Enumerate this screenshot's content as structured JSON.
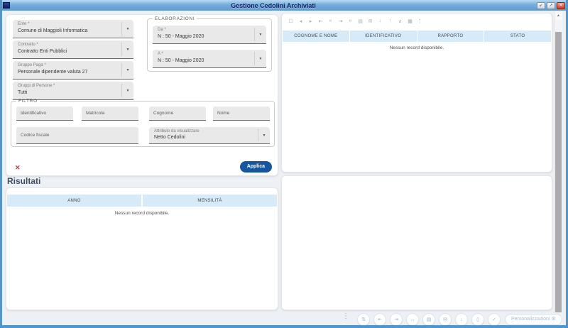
{
  "colors": {
    "accent": "#15569e",
    "titlebar": "#74addc",
    "table_header_bg": "#d6eaf7",
    "clear_red": "#c23b3b",
    "window_border": "#5494c7"
  },
  "window": {
    "title": "Gestione Cedolini Archiviati"
  },
  "icons": {
    "dropdown": "▼",
    "minimize": "↙",
    "maximize": "↗",
    "close": "✕",
    "clear": "✕",
    "more_vert": "⋮",
    "gear": "⚙",
    "scroll_up": "▲",
    "scroll_down": "▼"
  },
  "form": {
    "selects": [
      {
        "label": "Ente *",
        "value": "Comune di Maggioli Informatica"
      },
      {
        "label": "Contratto *",
        "value": "Contratto Enti Pubblici"
      },
      {
        "label": "Gruppo Paga *",
        "value": "Personale dipendente valuta 27"
      },
      {
        "label": "Gruppi di Persone *",
        "value": "Tutti"
      }
    ],
    "elaborazioni": {
      "legend": "ELABORAZIONI",
      "selects": [
        {
          "label": "Da *",
          "value": "N : 50 - Maggio 2020"
        },
        {
          "label": "A *",
          "value": "N : 50 - Maggio 2020"
        }
      ]
    },
    "filtro": {
      "legend": "FILTRO",
      "inputs": [
        {
          "placeholder": "Identificativo"
        },
        {
          "placeholder": "Matricola"
        },
        {
          "placeholder": "Cognome"
        },
        {
          "placeholder": "Nome"
        },
        {
          "placeholder": "Codice fiscale"
        }
      ],
      "attributo": {
        "label": "Attributo da visualizzare",
        "value": "Netto Cedolini"
      }
    },
    "apply_label": "Applica"
  },
  "results": {
    "title": "Risultati",
    "headers": [
      "ANNO",
      "MENSILITÀ"
    ],
    "empty_text": "Nessun record disponibile."
  },
  "archive": {
    "toolbar": [
      {
        "name": "select-all-icon",
        "glyph": "☐"
      },
      {
        "name": "nav-prev-icon",
        "glyph": "◂"
      },
      {
        "name": "nav-next-icon",
        "glyph": "▸"
      },
      {
        "name": "first-page-icon",
        "glyph": "⇤"
      },
      {
        "name": "page-back-icon",
        "glyph": "«"
      },
      {
        "name": "last-page-icon",
        "glyph": "⇥"
      },
      {
        "name": "page-forward-icon",
        "glyph": "»"
      },
      {
        "name": "copy-icon",
        "glyph": "▤"
      },
      {
        "name": "mail-icon",
        "glyph": "✉"
      },
      {
        "name": "download-icon",
        "glyph": "↓"
      },
      {
        "name": "upload-icon",
        "glyph": "↑"
      },
      {
        "name": "collapse-icon",
        "glyph": "∧"
      },
      {
        "name": "grid-icon",
        "glyph": "▦"
      },
      {
        "name": "more-icon",
        "glyph": "⋮"
      }
    ],
    "headers": [
      "COGNOME E NOME",
      "IDENTIFICATIVO",
      "RAPPORTO",
      "STATO"
    ],
    "empty_text": "Nessun record disponibile."
  },
  "bottom_toolbar": {
    "buttons": [
      {
        "name": "export-icon",
        "glyph": "⇅"
      },
      {
        "name": "first-page-icon",
        "glyph": "⇤"
      },
      {
        "name": "last-page-icon",
        "glyph": "⇥"
      },
      {
        "name": "expand-icon",
        "glyph": "↔"
      },
      {
        "name": "document-icon",
        "glyph": "▤"
      },
      {
        "name": "mail-icon",
        "glyph": "✉"
      },
      {
        "name": "download-icon",
        "glyph": "↓"
      },
      {
        "name": "report-icon",
        "glyph": "▯"
      },
      {
        "name": "check-circle-icon",
        "glyph": "✓"
      }
    ],
    "personalizzazioni_label": "Personalizzazioni"
  }
}
